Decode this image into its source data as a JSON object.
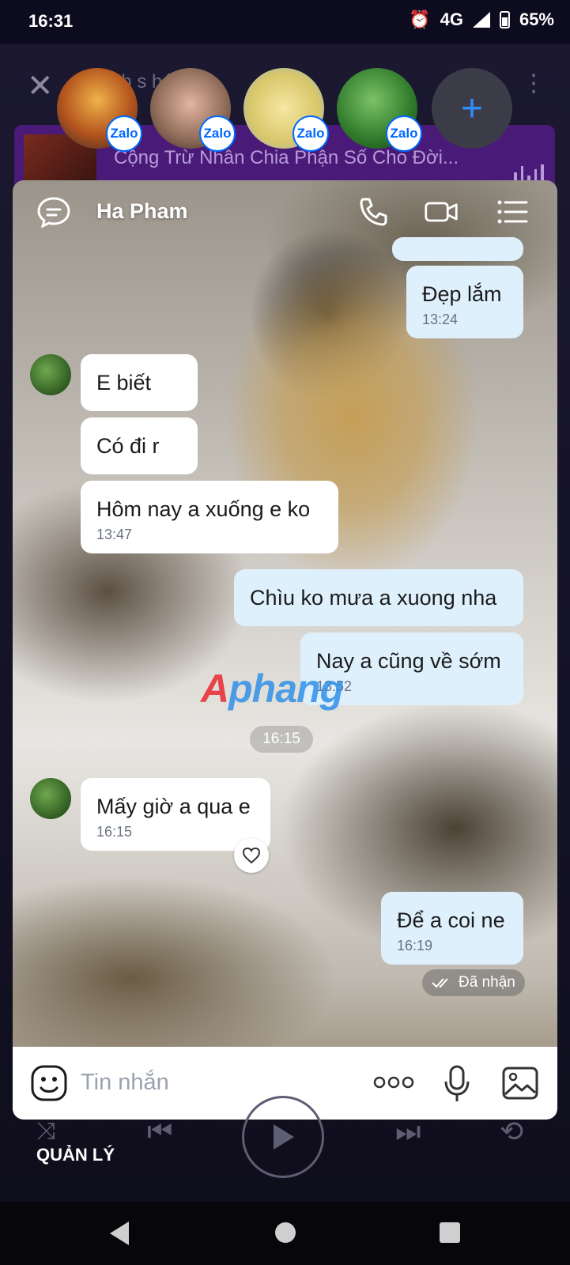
{
  "status_bar": {
    "time": "16:31",
    "network": "4G",
    "battery": "65%"
  },
  "background_app": {
    "title_partial": "nh s   hát 01",
    "banner_song": "Cộng Trừ Nhân Chia Phận Số Cho Đời...",
    "manage_label": "QUẢN LÝ"
  },
  "chat_heads": [
    {
      "badge": "Zalo",
      "color": "#d8892f"
    },
    {
      "badge": "Zalo",
      "color": "#c99a86"
    },
    {
      "badge": "Zalo",
      "color": "#e7d27a"
    },
    {
      "badge": "Zalo",
      "color": "#3f8a37"
    }
  ],
  "chat": {
    "contact_name": "Ha Pham",
    "messages": [
      {
        "dir": "out",
        "text": "Đẹp lắm",
        "time": "13:24"
      },
      {
        "dir": "in",
        "text": "E biết",
        "time": ""
      },
      {
        "dir": "in",
        "text": "Có đi r",
        "time": ""
      },
      {
        "dir": "in",
        "text": "Hôm nay a xuống e ko",
        "time": "13:47"
      },
      {
        "dir": "out",
        "text": "Chìu ko mưa a xuong nha",
        "time": ""
      },
      {
        "dir": "out",
        "text": "Nay a cũng về sớm",
        "time": "13:52"
      },
      {
        "dir": "in",
        "text": "Mấy giờ a qua e",
        "time": "16:15"
      },
      {
        "dir": "out",
        "text": "Để a coi ne",
        "time": "16:19"
      }
    ],
    "divider_time": "16:15",
    "delivery_status": "Đã nhận",
    "watermark": {
      "red": "A",
      "blue": "phang"
    },
    "input_placeholder": "Tin nhắn"
  },
  "colors": {
    "zalo_blue": "#0068ff",
    "incoming_bubble": "#ffffff",
    "outgoing_bubble": "#dff0fd",
    "banner_purple": "#4a1a78"
  }
}
